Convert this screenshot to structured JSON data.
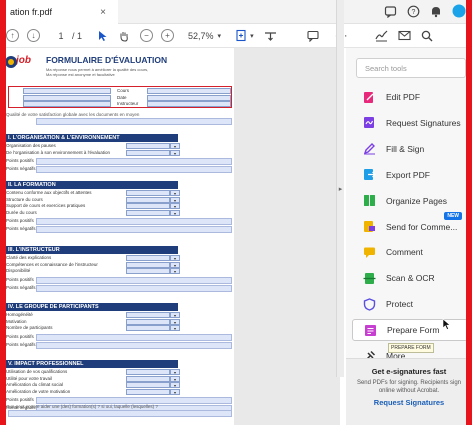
{
  "tab": {
    "title": "ation fr.pdf",
    "close": "×"
  },
  "window_icons": [
    "message-icon",
    "help-icon",
    "bell-icon",
    "profile-icon"
  ],
  "toolbar": {
    "page_current": "1",
    "page_total": "/ 1",
    "zoom": "52,7%",
    "zoom_caret": "▾"
  },
  "panel": {
    "search_placeholder": "Search tools",
    "tools": [
      {
        "label": "Edit PDF",
        "icon": "edit-pdf-icon",
        "color": "#e8287a"
      },
      {
        "label": "Request Signatures",
        "icon": "request-signatures-icon",
        "color": "#7b3fe4"
      },
      {
        "label": "Fill & Sign",
        "icon": "fill-sign-icon",
        "color": "#7b3fe4"
      },
      {
        "label": "Export PDF",
        "icon": "export-pdf-icon",
        "color": "#1f9ee8"
      },
      {
        "label": "Organize Pages",
        "icon": "organize-pages-icon",
        "color": "#2eae4a"
      },
      {
        "label": "Send for Comme...",
        "icon": "send-comment-icon",
        "color": "#f0b400",
        "badge": "NEW"
      },
      {
        "label": "Comment",
        "icon": "comment-icon",
        "color": "#f0b400"
      },
      {
        "label": "Scan & OCR",
        "icon": "scan-ocr-icon",
        "color": "#2eae4a"
      },
      {
        "label": "Protect",
        "icon": "protect-icon",
        "color": "#5b4fe0"
      },
      {
        "label": "Prepare Form",
        "icon": "prepare-form-icon",
        "color": "#c73fd0"
      },
      {
        "label": "More",
        "icon": "more-tools-icon",
        "color": "#333333"
      }
    ],
    "tooltip": "PREPARE FORM",
    "promo": {
      "title": "Get e-signatures fast",
      "desc": "Send PDFs for signing. Recipients sign online without Acrobat.",
      "link": "Request Signatures"
    }
  },
  "form": {
    "logo": "job",
    "title": "FORMULAIRE D'ÉVALUATION",
    "subtitle1": "Ma réponse nous permet à améliorer la qualité des cours,",
    "subtitle2": "Ma réponse est anonyme et facultative",
    "header_fields": [
      "Cours",
      "Date",
      "Instructeur"
    ],
    "overall_note": "Qualité de votre satisfaction globale avec les documents en moyen",
    "sections": [
      {
        "title": "I. L'ORGANISATION & L'ENVIRONNEMENT",
        "rows": [
          "Organisation des pauses",
          "De l'organisation à son environnement à l'évaluation"
        ],
        "sub": [
          "Points positifs",
          "Points négatifs"
        ]
      },
      {
        "title": "II. LA FORMATION",
        "rows": [
          "Contenu conforme aux objectifs et attentes",
          "Structure du cours",
          "Support de cours et exercices pratiques",
          "Durée du cours"
        ],
        "sub": [
          "Points positifs",
          "Points négatifs"
        ]
      },
      {
        "title": "III. L'INSTRUCTEUR",
        "rows": [
          "Clarté des explications",
          "Compétences et connaissance de l'instructeur",
          "Disponibilité"
        ],
        "sub": [
          "Points positifs",
          "Points négatifs"
        ]
      },
      {
        "title": "IV. LE GROUPE DE PARTICIPANTS",
        "rows": [
          "Homogénéité",
          "Motivation",
          "Nombre de participants"
        ],
        "sub": [
          "Points positifs",
          "Points négatifs"
        ]
      },
      {
        "title": "V. IMPACT PROFESSIONNEL",
        "rows": [
          "Utilisation de vos qualifications",
          "Utilité pour votre travail",
          "Amélioration du climat social",
          "Amélioration de votre motivation"
        ],
        "sub": [
          "Points positifs",
          "Points négatifs"
        ]
      }
    ],
    "final_note": "Que peut encore aider une (des) formation(s) ? si oui, laquelle (lesquelles) ?"
  }
}
